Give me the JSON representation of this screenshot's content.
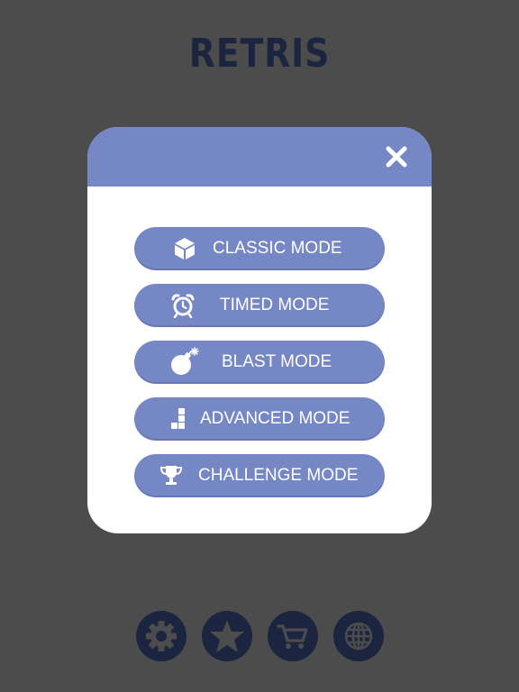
{
  "title": "RETRIS",
  "modal": {
    "close_icon": "close-icon",
    "modes": [
      {
        "label": "CLASSIC MODE",
        "icon": "cube-icon"
      },
      {
        "label": "TIMED MODE",
        "icon": "alarm-clock-icon"
      },
      {
        "label": "BLAST MODE",
        "icon": "bomb-icon"
      },
      {
        "label": "ADVANCED MODE",
        "icon": "blocks-icon"
      },
      {
        "label": "CHALLENGE MODE",
        "icon": "trophy-icon"
      }
    ]
  },
  "bottom_bar": [
    {
      "icon": "gear-icon"
    },
    {
      "icon": "star-icon"
    },
    {
      "icon": "cart-icon"
    },
    {
      "icon": "globe-icon"
    }
  ],
  "colors": {
    "background": "#4c4c4c",
    "accent": "#7587c4",
    "dark": "#1b2540",
    "panel": "#ffffff"
  }
}
